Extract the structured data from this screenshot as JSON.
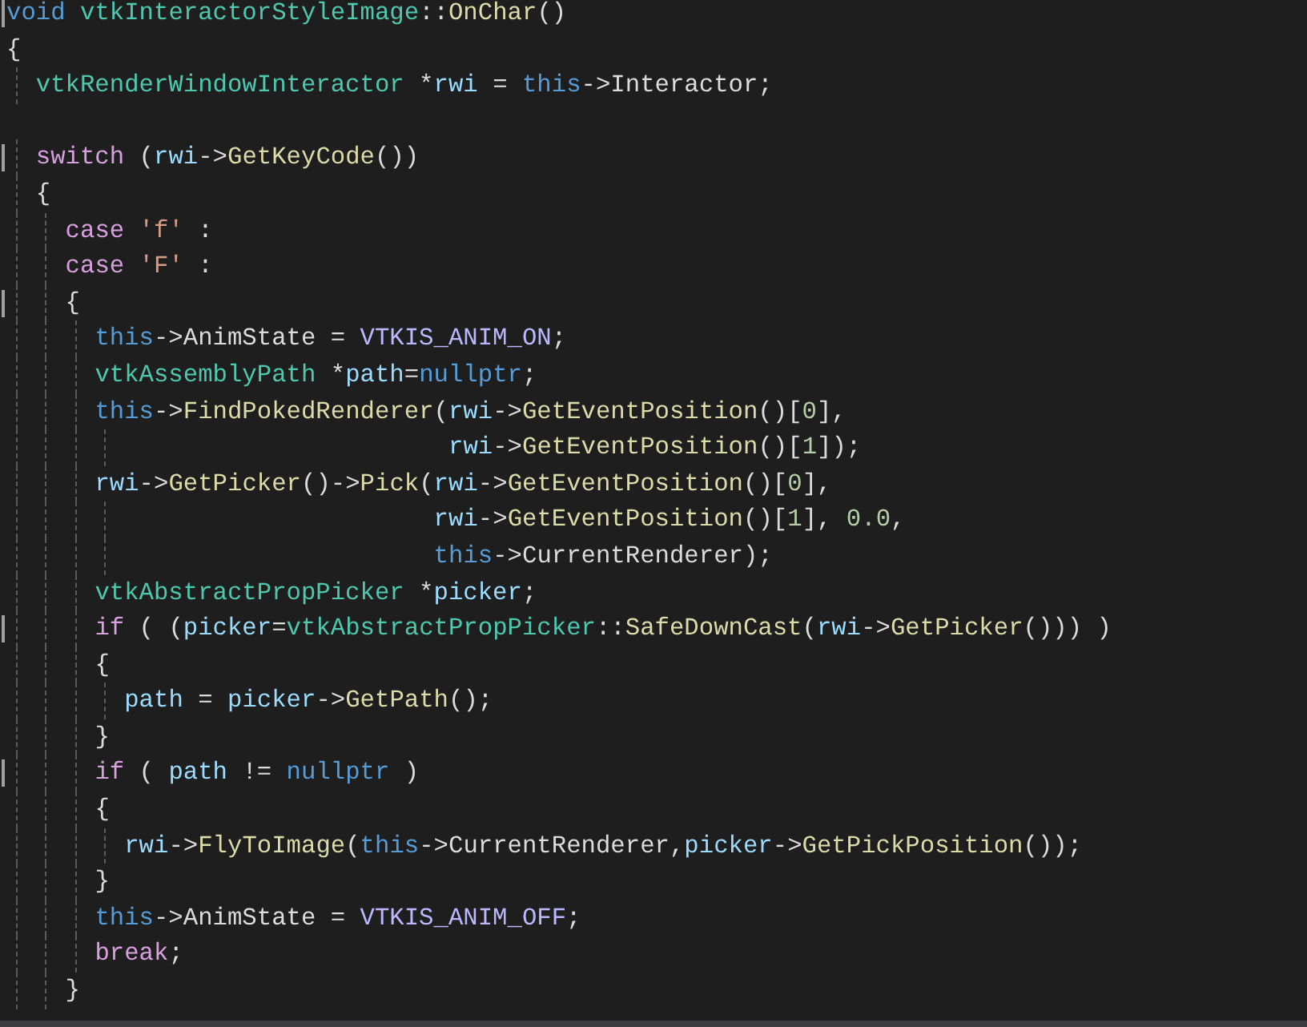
{
  "editor": {
    "lines": [
      {
        "marker": true,
        "tokens": [
          {
            "kind": "kw",
            "text": "void "
          },
          {
            "kind": "type",
            "text": "vtkInteractorStyleImage"
          },
          {
            "kind": "p",
            "text": "::"
          },
          {
            "kind": "fn",
            "text": "OnChar"
          },
          {
            "kind": "p",
            "text": "()"
          }
        ]
      },
      {
        "marker": false,
        "tokens": [
          {
            "kind": "p",
            "text": "{"
          }
        ]
      },
      {
        "marker": false,
        "tokens": [
          {
            "kind": "type",
            "text": "  vtkRenderWindowInteractor"
          },
          {
            "kind": "p",
            "text": " *"
          },
          {
            "kind": "var",
            "text": "rwi"
          },
          {
            "kind": "p",
            "text": " = "
          },
          {
            "kind": "kw",
            "text": "this"
          },
          {
            "kind": "p",
            "text": "->Interactor;"
          }
        ]
      },
      {
        "marker": false
      },
      {
        "marker": true,
        "tokens": [
          {
            "kind": "ctl",
            "text": "  switch"
          },
          {
            "kind": "p",
            "text": " ("
          },
          {
            "kind": "var",
            "text": "rwi"
          },
          {
            "kind": "p",
            "text": "->"
          },
          {
            "kind": "fn",
            "text": "GetKeyCode"
          },
          {
            "kind": "p",
            "text": "())"
          }
        ]
      },
      {
        "marker": false,
        "tokens": [
          {
            "kind": "p",
            "text": "  {"
          }
        ]
      },
      {
        "marker": false,
        "tokens": [
          {
            "kind": "ctl",
            "text": "    case "
          },
          {
            "kind": "str",
            "text": "'f'"
          },
          {
            "kind": "p",
            "text": " :"
          }
        ]
      },
      {
        "marker": false,
        "tokens": [
          {
            "kind": "ctl",
            "text": "    case "
          },
          {
            "kind": "str",
            "text": "'F'"
          },
          {
            "kind": "p",
            "text": " :"
          }
        ]
      },
      {
        "marker": true,
        "tokens": [
          {
            "kind": "p",
            "text": "    {"
          }
        ]
      },
      {
        "marker": false,
        "tokens": [
          {
            "kind": "kw",
            "text": "      this"
          },
          {
            "kind": "p",
            "text": "->AnimState = "
          },
          {
            "kind": "macro",
            "text": "VTKIS_ANIM_ON"
          },
          {
            "kind": "p",
            "text": ";"
          }
        ]
      },
      {
        "marker": false,
        "tokens": [
          {
            "kind": "type",
            "text": "      vtkAssemblyPath"
          },
          {
            "kind": "p",
            "text": " *"
          },
          {
            "kind": "var",
            "text": "path"
          },
          {
            "kind": "p",
            "text": "="
          },
          {
            "kind": "kw",
            "text": "nullptr"
          },
          {
            "kind": "p",
            "text": ";"
          }
        ]
      },
      {
        "marker": false,
        "tokens": [
          {
            "kind": "kw",
            "text": "      this"
          },
          {
            "kind": "p",
            "text": "->"
          },
          {
            "kind": "fn",
            "text": "FindPokedRenderer"
          },
          {
            "kind": "p",
            "text": "("
          },
          {
            "kind": "var",
            "text": "rwi"
          },
          {
            "kind": "p",
            "text": "->"
          },
          {
            "kind": "fn",
            "text": "GetEventPosition"
          },
          {
            "kind": "p",
            "text": "()["
          },
          {
            "kind": "num",
            "text": "0"
          },
          {
            "kind": "p",
            "text": "],"
          }
        ]
      },
      {
        "marker": false,
        "tokens": [
          {
            "kind": "var",
            "text": "                              rwi"
          },
          {
            "kind": "p",
            "text": "->"
          },
          {
            "kind": "fn",
            "text": "GetEventPosition"
          },
          {
            "kind": "p",
            "text": "()["
          },
          {
            "kind": "num",
            "text": "1"
          },
          {
            "kind": "p",
            "text": "]);"
          }
        ]
      },
      {
        "marker": false,
        "tokens": [
          {
            "kind": "var",
            "text": "      rwi"
          },
          {
            "kind": "p",
            "text": "->"
          },
          {
            "kind": "fn",
            "text": "GetPicker"
          },
          {
            "kind": "p",
            "text": "()->"
          },
          {
            "kind": "fn",
            "text": "Pick"
          },
          {
            "kind": "p",
            "text": "("
          },
          {
            "kind": "var",
            "text": "rwi"
          },
          {
            "kind": "p",
            "text": "->"
          },
          {
            "kind": "fn",
            "text": "GetEventPosition"
          },
          {
            "kind": "p",
            "text": "()["
          },
          {
            "kind": "num",
            "text": "0"
          },
          {
            "kind": "p",
            "text": "],"
          }
        ]
      },
      {
        "marker": false,
        "tokens": [
          {
            "kind": "var",
            "text": "                             rwi"
          },
          {
            "kind": "p",
            "text": "->"
          },
          {
            "kind": "fn",
            "text": "GetEventPosition"
          },
          {
            "kind": "p",
            "text": "()["
          },
          {
            "kind": "num",
            "text": "1"
          },
          {
            "kind": "p",
            "text": "], "
          },
          {
            "kind": "num",
            "text": "0.0"
          },
          {
            "kind": "p",
            "text": ","
          }
        ]
      },
      {
        "marker": false,
        "tokens": [
          {
            "kind": "kw",
            "text": "                             this"
          },
          {
            "kind": "p",
            "text": "->CurrentRenderer);"
          }
        ]
      },
      {
        "marker": false,
        "tokens": [
          {
            "kind": "type",
            "text": "      vtkAbstractPropPicker"
          },
          {
            "kind": "p",
            "text": " *"
          },
          {
            "kind": "var",
            "text": "picker"
          },
          {
            "kind": "p",
            "text": ";"
          }
        ]
      },
      {
        "marker": true,
        "tokens": [
          {
            "kind": "ctl",
            "text": "      if"
          },
          {
            "kind": "p",
            "text": " ( ("
          },
          {
            "kind": "var",
            "text": "picker"
          },
          {
            "kind": "p",
            "text": "="
          },
          {
            "kind": "type",
            "text": "vtkAbstractPropPicker"
          },
          {
            "kind": "p",
            "text": "::"
          },
          {
            "kind": "fn",
            "text": "SafeDownCast"
          },
          {
            "kind": "p",
            "text": "("
          },
          {
            "kind": "var",
            "text": "rwi"
          },
          {
            "kind": "p",
            "text": "->"
          },
          {
            "kind": "fn",
            "text": "GetPicker"
          },
          {
            "kind": "p",
            "text": "())) )"
          }
        ]
      },
      {
        "marker": false,
        "tokens": [
          {
            "kind": "p",
            "text": "      {"
          }
        ]
      },
      {
        "marker": false,
        "tokens": [
          {
            "kind": "var",
            "text": "        path"
          },
          {
            "kind": "p",
            "text": " = "
          },
          {
            "kind": "var",
            "text": "picker"
          },
          {
            "kind": "p",
            "text": "->"
          },
          {
            "kind": "fn",
            "text": "GetPath"
          },
          {
            "kind": "p",
            "text": "();"
          }
        ]
      },
      {
        "marker": false,
        "tokens": [
          {
            "kind": "p",
            "text": "      }"
          }
        ]
      },
      {
        "marker": true,
        "tokens": [
          {
            "kind": "ctl",
            "text": "      if"
          },
          {
            "kind": "p",
            "text": " ( "
          },
          {
            "kind": "var",
            "text": "path"
          },
          {
            "kind": "p",
            "text": " != "
          },
          {
            "kind": "kw",
            "text": "nullptr"
          },
          {
            "kind": "p",
            "text": " )"
          }
        ]
      },
      {
        "marker": false,
        "tokens": [
          {
            "kind": "p",
            "text": "      {"
          }
        ]
      },
      {
        "marker": false,
        "tokens": [
          {
            "kind": "var",
            "text": "        rwi"
          },
          {
            "kind": "p",
            "text": "->"
          },
          {
            "kind": "fn",
            "text": "FlyToImage"
          },
          {
            "kind": "p",
            "text": "("
          },
          {
            "kind": "kw",
            "text": "this"
          },
          {
            "kind": "p",
            "text": "->CurrentRenderer,"
          },
          {
            "kind": "var",
            "text": "picker"
          },
          {
            "kind": "p",
            "text": "->"
          },
          {
            "kind": "fn",
            "text": "GetPickPosition"
          },
          {
            "kind": "p",
            "text": "());"
          }
        ]
      },
      {
        "marker": false,
        "tokens": [
          {
            "kind": "p",
            "text": "      }"
          }
        ]
      },
      {
        "marker": false,
        "tokens": [
          {
            "kind": "kw",
            "text": "      this"
          },
          {
            "kind": "p",
            "text": "->AnimState = "
          },
          {
            "kind": "macro",
            "text": "VTKIS_ANIM_OFF"
          },
          {
            "kind": "p",
            "text": ";"
          }
        ]
      },
      {
        "marker": false,
        "tokens": [
          {
            "kind": "ctl",
            "text": "      break"
          },
          {
            "kind": "p",
            "text": ";"
          }
        ]
      },
      {
        "marker": false,
        "tokens": [
          {
            "kind": "p",
            "text": "    }"
          }
        ]
      }
    ]
  }
}
